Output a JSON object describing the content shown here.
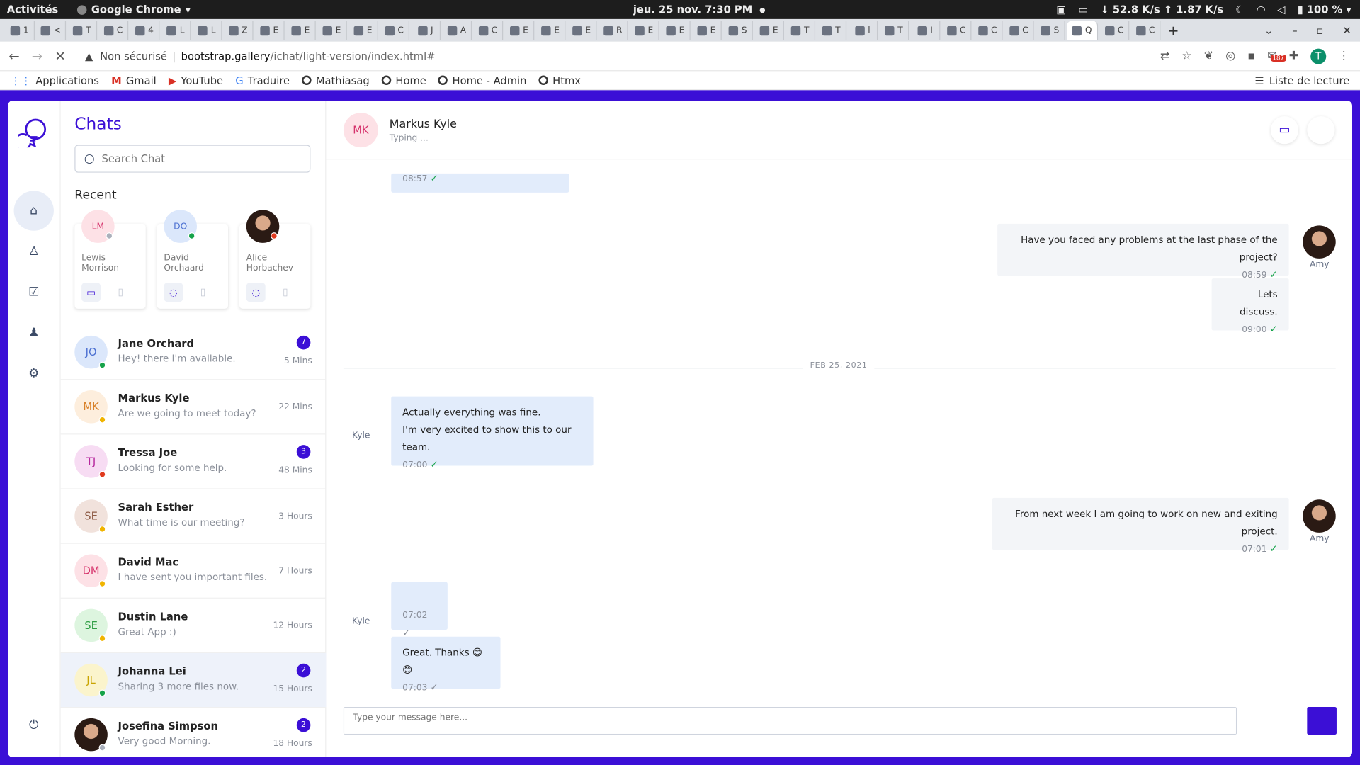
{
  "system": {
    "activities": "Activités",
    "app": "Google Chrome",
    "clock": "jeu. 25 nov.  7:30 PM",
    "net": "52.8 K/s ↑ 1.87 K/s",
    "battery": "100 %"
  },
  "tabs": [
    "1",
    "<",
    "T",
    "C",
    "4",
    "L",
    "L",
    "Z",
    "E",
    "E",
    "E",
    "E",
    "C",
    "J",
    "A",
    "C",
    "E",
    "E",
    "E",
    "R",
    "E",
    "E",
    "E",
    "S",
    "E",
    "T",
    "T",
    "l",
    "T",
    "I",
    "C",
    "C",
    "C",
    "S",
    "Q",
    "C",
    "C"
  ],
  "addressbar": {
    "security": "Non sécurisé",
    "host": "bootstrap.gallery",
    "path": "/ichat/light-version/index.html#",
    "mail_count": "187"
  },
  "bookmarks": [
    "Applications",
    "Gmail",
    "YouTube",
    "Traduire",
    "Mathiasag",
    "Home",
    "Home - Admin",
    "Htmx"
  ],
  "reading_list": "Liste de lecture",
  "chats": {
    "title": "Chats",
    "search_placeholder": "Search Chat",
    "recent_title": "Recent",
    "recent": [
      {
        "initials": "LM",
        "name": "Lewis Morrison",
        "status": "grey"
      },
      {
        "initials": "DO",
        "name": "David Orchaard",
        "status": "green"
      },
      {
        "initials": "",
        "name": "Alice Horbachev",
        "status": "red"
      }
    ],
    "list": [
      {
        "initials": "JO",
        "name": "Jane Orchard",
        "msg": "Hey! there I'm available.",
        "time": "5 Mins",
        "badge": "7",
        "bg": "#dbe7fb",
        "fg": "#4a6fd1",
        "status": "#16a34a"
      },
      {
        "initials": "MK",
        "name": "Markus Kyle",
        "msg": "Are we going to meet today?",
        "time": "22 Mins",
        "badge": "",
        "bg": "#fdeedd",
        "fg": "#d9822b",
        "status": "#f0b400"
      },
      {
        "initials": "TJ",
        "name": "Tressa Joe",
        "msg": "Looking for some help.",
        "time": "48 Mins",
        "badge": "3",
        "bg": "#f7dcf3",
        "fg": "#b6279d",
        "status": "#e03a1e"
      },
      {
        "initials": "SE",
        "name": "Sarah Esther",
        "msg": "What time is our meeting?",
        "time": "3 Hours",
        "badge": "",
        "bg": "#f1e2dc",
        "fg": "#8d5a44",
        "status": "#f0b400"
      },
      {
        "initials": "DM",
        "name": "David Mac",
        "msg": "I have sent you important files.",
        "time": "7 Hours",
        "badge": "",
        "bg": "#fde1e6",
        "fg": "#d6336c",
        "status": "#f0b400"
      },
      {
        "initials": "SE",
        "name": "Dustin Lane",
        "msg": "Great App :)",
        "time": "12 Hours",
        "badge": "",
        "bg": "#ddf5df",
        "fg": "#2f9e44",
        "status": "#f0b400"
      },
      {
        "initials": "JL",
        "name": "Johanna Lei",
        "msg": "Sharing 3 more files now.",
        "time": "15 Hours",
        "badge": "2",
        "bg": "#fbf4cc",
        "fg": "#c9a400",
        "status": "#16a34a"
      },
      {
        "initials": "",
        "name": "Josefina Simpson",
        "msg": "Very good Morning.",
        "time": "18 Hours",
        "badge": "2",
        "bg": "photo",
        "fg": "",
        "status": "#aab0bb"
      }
    ]
  },
  "conversation": {
    "contact_initials": "MK",
    "contact_name": "Markus Kyle",
    "contact_status": "Typing ...",
    "date_separator": "FEB 25, 2021",
    "compose_placeholder": "Type your message here...",
    "messages": [
      {
        "from": "",
        "text": "",
        "time": "08:57"
      },
      {
        "from": "Amy",
        "text": "Have you faced any problems at the last phase of the project?",
        "time": "08:59"
      },
      {
        "from": "Amy",
        "text": "Lets discuss.",
        "time": "09:00"
      },
      {
        "from": "Kyle",
        "text": "Actually everything was fine.",
        "text2": "I'm very excited to show this to our team.",
        "time": "07:00"
      },
      {
        "from": "Amy",
        "text": "From next week I am going to work on new and exiting project.",
        "time": "07:01"
      },
      {
        "from": "Kyle",
        "text": "",
        "time": "07:02"
      },
      {
        "from": "Kyle",
        "text": "Great. Thanks 😊😊",
        "time": "07:03"
      }
    ]
  }
}
